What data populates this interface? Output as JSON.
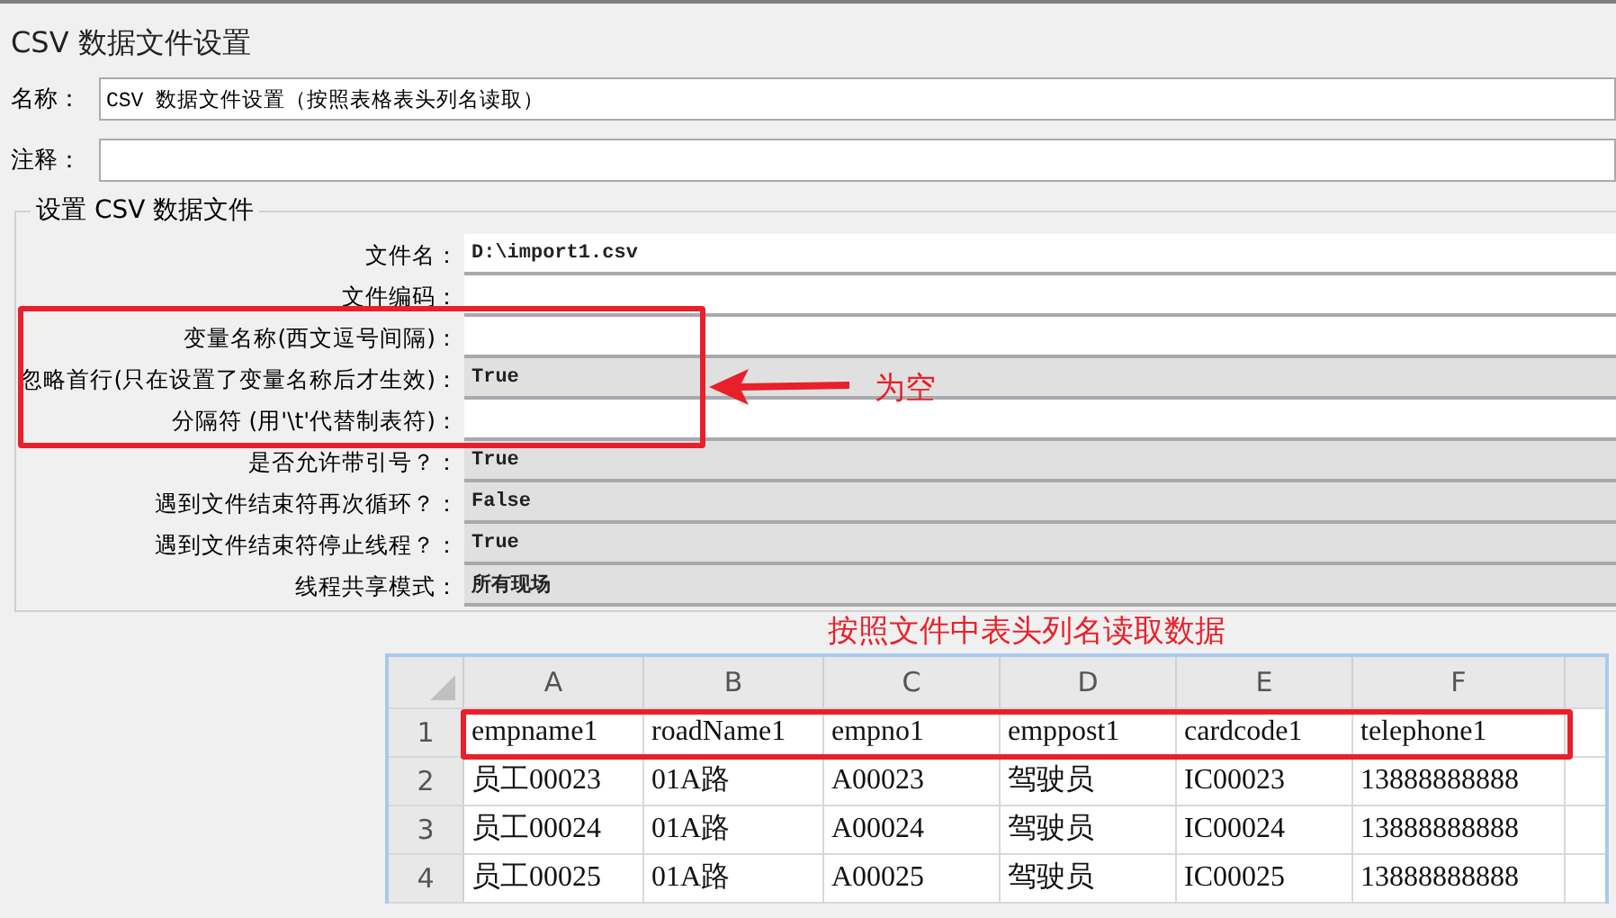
{
  "window": {
    "title": "CSV 数据文件设置"
  },
  "name_field": {
    "label": "名称：",
    "value": "CSV 数据文件设置（按照表格表头列名读取）"
  },
  "comment_field": {
    "label": "注释："
  },
  "settings": {
    "legend": "设置 CSV 数据文件",
    "rows": [
      {
        "label": "文件名：",
        "kind": "text",
        "value": "D:\\import1.csv"
      },
      {
        "label": "文件编码：",
        "kind": "text"
      },
      {
        "label": "变量名称(西文逗号间隔)：",
        "kind": "text"
      },
      {
        "label": "忽略首行(只在设置了变量名称后才生效)：",
        "kind": "combo",
        "value": "True"
      },
      {
        "label": "分隔符 (用'\\t'代替制表符)：",
        "kind": "text"
      },
      {
        "label": "是否允许带引号？：",
        "kind": "combo",
        "value": "True"
      },
      {
        "label": "遇到文件结束符再次循环？：",
        "kind": "combo",
        "value": "False"
      },
      {
        "label": "遇到文件结束符停止线程？：",
        "kind": "combo",
        "value": "True"
      },
      {
        "label": "线程共享模式：",
        "kind": "combo",
        "value": "所有现场"
      }
    ]
  },
  "annotations": {
    "empty_note": "为空",
    "sheet_note": "按照文件中表头列名读取数据"
  },
  "sheet": {
    "columns": [
      "A",
      "B",
      "C",
      "D",
      "E",
      "F"
    ],
    "rows": [
      {
        "number": "1",
        "cells": [
          "empname1",
          "roadName1",
          "empno1",
          "emppost1",
          "cardcode1",
          "telephone1"
        ]
      },
      {
        "number": "2",
        "cells": [
          "员工00023",
          "01A路",
          "A00023",
          "驾驶员",
          "IC00023",
          "13888888888"
        ]
      },
      {
        "number": "3",
        "cells": [
          "员工00024",
          "01A路",
          "A00024",
          "驾驶员",
          "IC00024",
          "13888888888"
        ]
      },
      {
        "number": "4",
        "cells": [
          "员工00025",
          "01A路",
          "A00025",
          "驾驶员",
          "IC00025",
          "13888888888"
        ]
      }
    ]
  }
}
